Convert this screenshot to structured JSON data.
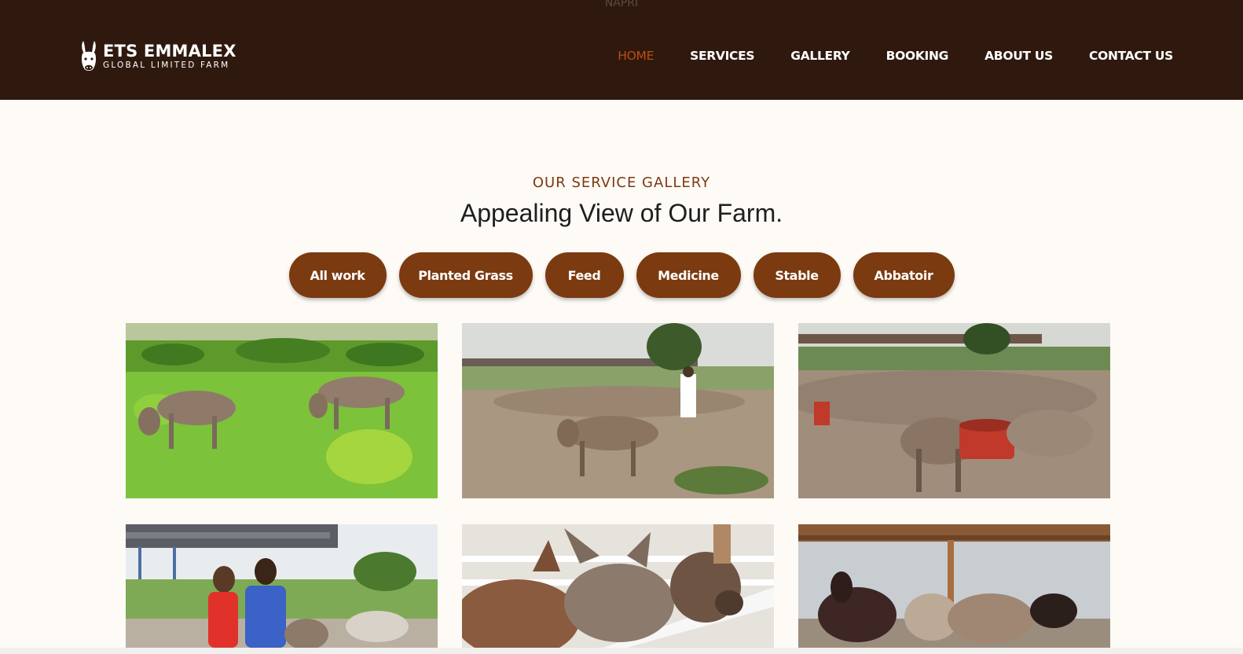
{
  "header": {
    "stray_text": "NAPRI",
    "logo": {
      "icon": "donkey-head-icon",
      "title": "ETS EMMALEX",
      "subtitle": "GLOBAL LIMITED FARM"
    },
    "nav": [
      {
        "label": "HOME",
        "active": true
      },
      {
        "label": "SERVICES"
      },
      {
        "label": "GALLERY"
      },
      {
        "label": "BOOKING"
      },
      {
        "label": "ABOUT US"
      },
      {
        "label": "CONTACT US"
      }
    ]
  },
  "section": {
    "kicker": "OUR SERVICE GALLERY",
    "title": "Appealing View of Our Farm."
  },
  "filters": [
    "All work",
    "Planted Grass",
    "Feed",
    "Medicine",
    "Stable",
    "Abbatoir"
  ],
  "colors": {
    "header_bg": "#2f190f",
    "accent_brown": "#7b3a10",
    "active_nav": "#bf4d12",
    "page_bg": "#fefaf6"
  }
}
